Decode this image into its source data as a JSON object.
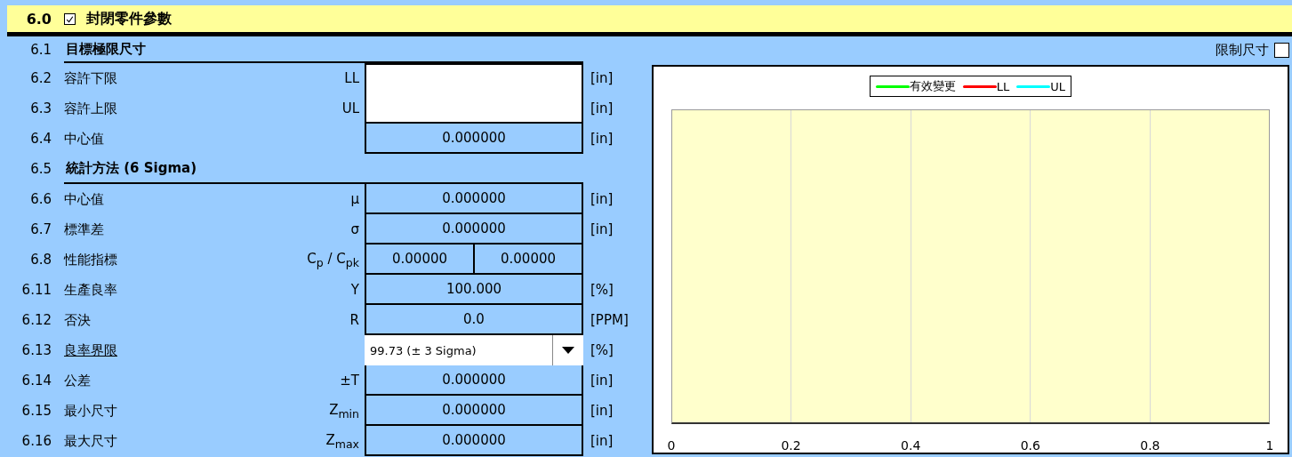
{
  "header": {
    "number": "6.0",
    "checked": true,
    "title": "封閉零件參數"
  },
  "limit": {
    "label": "限制尺寸",
    "checked": false
  },
  "rows": [
    {
      "kind": "section",
      "number": "6.1",
      "label": "目標極限尺寸"
    },
    {
      "kind": "input",
      "number": "6.2",
      "label": "容許下限",
      "symbol": "LL",
      "unit": "[in]"
    },
    {
      "kind": "input",
      "number": "6.3",
      "label": "容許上限",
      "symbol": "UL",
      "unit": "[in]"
    },
    {
      "kind": "value",
      "number": "6.4",
      "label": "中心值",
      "value": "0.000000",
      "unit": "[in]"
    },
    {
      "kind": "section",
      "number": "6.5",
      "label": "統計方法 (6 Sigma)"
    },
    {
      "kind": "value",
      "number": "6.6",
      "label": "中心值",
      "symbol": "μ",
      "value": "0.000000",
      "unit": "[in]"
    },
    {
      "kind": "value",
      "number": "6.7",
      "label": "標準差",
      "symbol": "σ",
      "value": "0.000000",
      "unit": "[in]"
    },
    {
      "kind": "pair",
      "number": "6.8",
      "label": "性能指標",
      "symbol": "C$_{p}$ / C$_{pk}$",
      "values": [
        "0.00000",
        "0.00000"
      ]
    },
    {
      "kind": "value",
      "number": "6.11",
      "label": "生產良率",
      "symbol": "Y",
      "value": "100.000",
      "unit": "[%]"
    },
    {
      "kind": "value",
      "number": "6.12",
      "label": "否決",
      "symbol": "R",
      "value": "0.0",
      "unit": "[PPM]"
    },
    {
      "kind": "dropdown",
      "number": "6.13",
      "label": "良率界限",
      "link": true,
      "value": "99.73  (± 3 Sigma)",
      "unit": "[%]"
    },
    {
      "kind": "value",
      "number": "6.14",
      "label": "公差",
      "symbol": "±T",
      "value": "0.000000",
      "unit": "[in]"
    },
    {
      "kind": "value",
      "number": "6.15",
      "label": "最小尺寸",
      "symbol": "Z$_{min}$",
      "value": "0.000000",
      "unit": "[in]"
    },
    {
      "kind": "value",
      "number": "6.16",
      "label": "最大尺寸",
      "symbol": "Z$_{max}$",
      "value": "0.000000",
      "unit": "[in]"
    }
  ],
  "chart": {
    "legend": [
      {
        "label": "有效變更",
        "color": "#00ff00"
      },
      {
        "label": "LL",
        "color": "#ff0000"
      },
      {
        "label": "UL",
        "color": "#00ffff"
      }
    ],
    "x_ticks": [
      "0",
      "0.2",
      "0.4",
      "0.6",
      "0.8",
      "1"
    ]
  }
}
